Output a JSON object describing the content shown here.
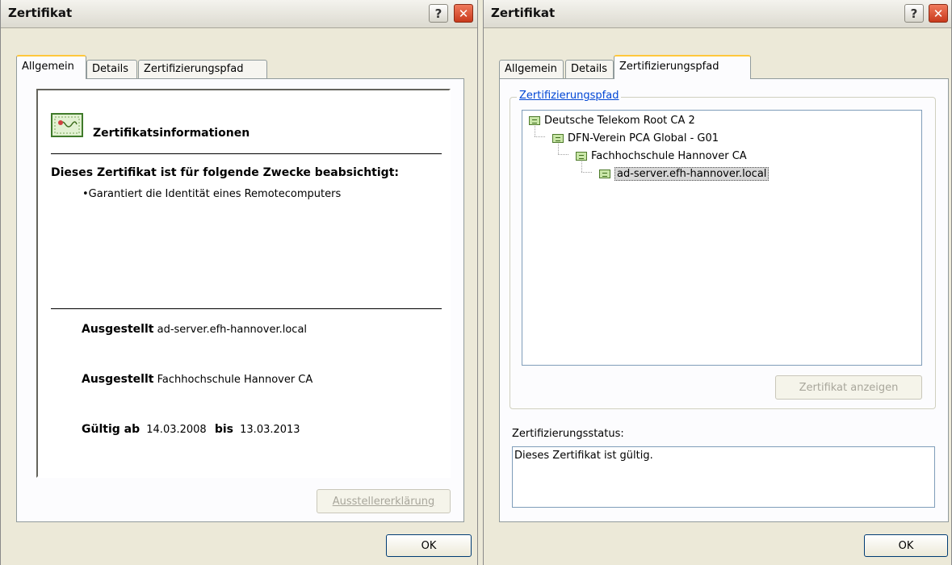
{
  "left_dialog": {
    "title": "Zertifikat",
    "help_glyph": "?",
    "close_glyph": "✕",
    "tabs": [
      "Allgemein",
      "Details",
      "Zertifizierungspfad"
    ],
    "active_tab": "Allgemein",
    "info_heading": "Zertifikatsinformationen",
    "purpose_heading": "Dieses Zertifikat ist für folgende Zwecke beabsichtigt:",
    "purposes": [
      "•Garantiert die Identität eines Remotecomputers"
    ],
    "issued_to_label": "Ausgestellt",
    "issued_to_value": "ad-server.efh-hannover.local",
    "issued_by_label": "Ausgestellt",
    "issued_by_value": "Fachhochschule Hannover CA",
    "valid_from_label": "Gültig ab",
    "valid_from": "14.03.2008",
    "valid_to_label": "bis",
    "valid_to": "13.03.2013",
    "issuer_statement_button": "Ausstellererklärung",
    "ok_button": "OK"
  },
  "right_dialog": {
    "title": "Zertifikat",
    "help_glyph": "?",
    "close_glyph": "✕",
    "tabs": [
      "Allgemein",
      "Details",
      "Zertifizierungspfad"
    ],
    "active_tab": "Zertifizierungspfad",
    "path_group_label": "Zertifizierungspfad",
    "path_nodes": [
      "Deutsche Telekom Root CA 2",
      "DFN-Verein PCA Global - G01",
      "Fachhochschule Hannover CA",
      "ad-server.efh-hannover.local"
    ],
    "selected_node": "ad-server.efh-hannover.local",
    "view_cert_button": "Zertifikat anzeigen",
    "status_label": "Zertifizierungsstatus:",
    "status_text": "Dieses Zertifikat ist gültig.",
    "ok_button": "OK"
  },
  "colors": {
    "dialog_bg": "#ece9d8",
    "active_tab_accent": "#ffc83c",
    "selection": "#d8d8d8"
  }
}
